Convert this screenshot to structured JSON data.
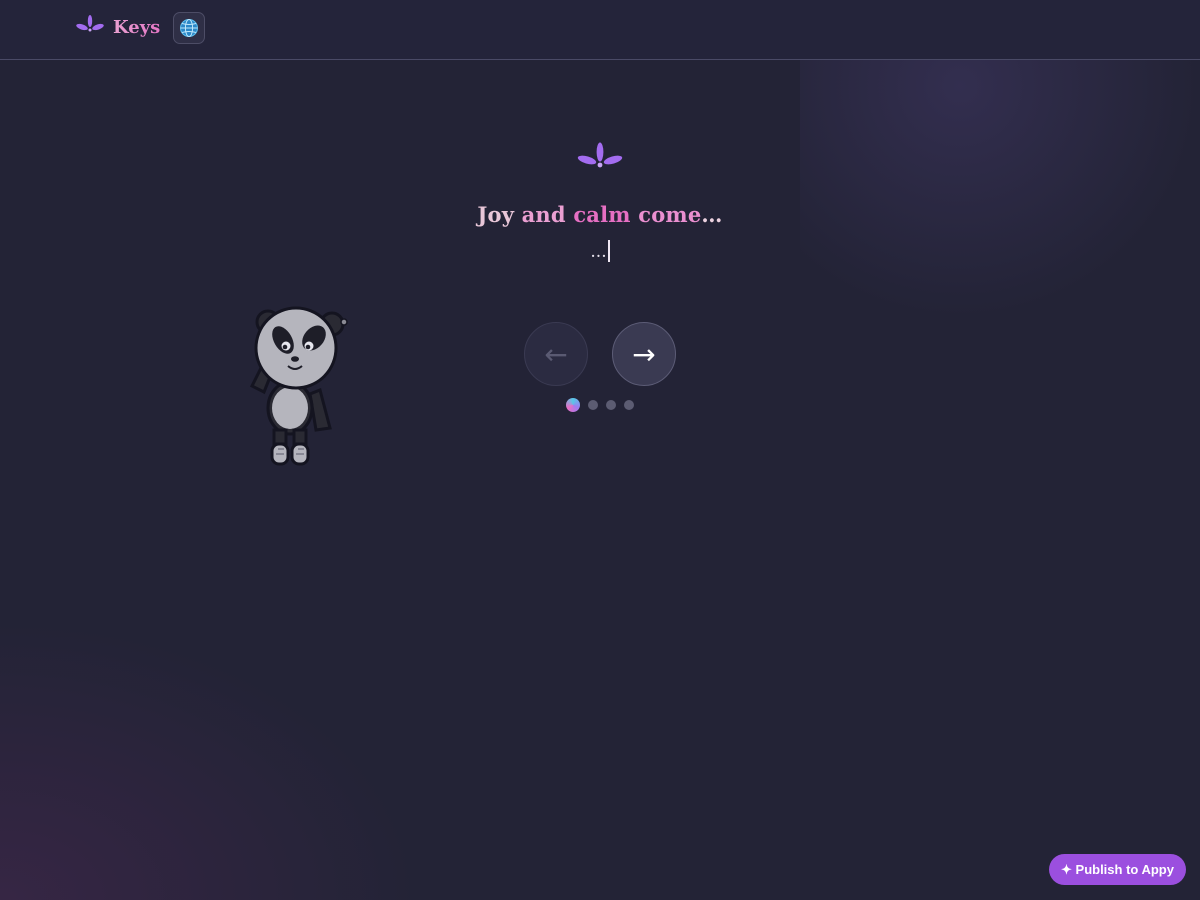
{
  "header": {
    "brand": "Keys",
    "logo_icon": "lotus-icon",
    "language_icon": "globe-icon"
  },
  "hero": {
    "logo_icon": "lotus-icon",
    "title_words": [
      "Joy",
      "and",
      "calm",
      "come",
      "…"
    ],
    "typing_text": "..."
  },
  "navigation": {
    "prev_label": "←",
    "next_label": "→",
    "total_steps": 4,
    "current_step": 1
  },
  "publish": {
    "label": "✦ Publish to Appy"
  },
  "colors": {
    "background": "#232336",
    "accent_pink": "#e66fc3",
    "accent_purple": "#9b4fdf",
    "logo_purple": "#a36cf0"
  }
}
